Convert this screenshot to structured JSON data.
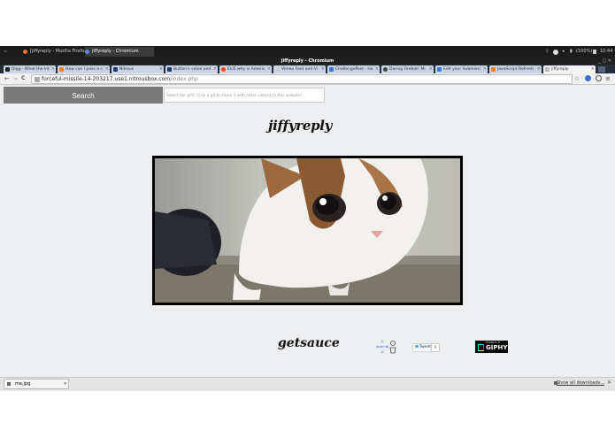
{
  "taskbar": {
    "menu_label": "~",
    "tasks": [
      {
        "label": "[jiffyreply - Mozilla Firefox]",
        "color": "#e8772e"
      },
      {
        "label": "jiffyreply - Chromium",
        "color": "#5b8fd9"
      }
    ],
    "battery": "(100%)",
    "time": "10:44"
  },
  "window": {
    "title": "jiffyreply - Chromium",
    "controls": "_ ▢ ✕"
  },
  "tabs": [
    {
      "label": "Digg - What the Inte",
      "fav": "#222222"
    },
    {
      "label": "How can I pass a c",
      "fav": "#f48024"
    },
    {
      "label": "Nitrous",
      "fav": "#1e3a6e"
    },
    {
      "label": "Button's value and",
      "fav": "#1e3a6e"
    },
    {
      "label": "ELI5 why is Americ",
      "fav": "#ff4500"
    },
    {
      "label": "Vimeo Font and Vi",
      "fav": "#cccccc"
    },
    {
      "label": "ChallengePost - Ha",
      "fav": "#3a7bd5"
    },
    {
      "label": "Daring Fireball: Mi",
      "fav": "#444444"
    },
    {
      "label": "Edit your Submissi",
      "fav": "#3a7bd5"
    },
    {
      "label": "JavaScript Refresh",
      "fav": "#f48024"
    },
    {
      "label": "jiffyreply",
      "fav": "#bbbbbb"
    }
  ],
  "address": {
    "host": "forceful-missile-14-203217.use1.nitrousbox.com",
    "path": "/index.php"
  },
  "nav": {
    "back": "←",
    "forward": "→",
    "reload": "C",
    "star": "☆",
    "menu": "≡"
  },
  "search": {
    "button_label": "Search",
    "placeholder": "Search for gifs! Click a gif to share it with other visitors to this website!"
  },
  "site": {
    "logo": "jiffyreply",
    "footer_logo": "getsauce"
  },
  "widgets": {
    "submit_label": "submit",
    "tweet_label": "Tweet",
    "tweet_count": "0",
    "giphy_small": "POWERED BY",
    "giphy_brand": "GIPHY"
  },
  "downloads": {
    "file": "me.jpg",
    "arrow": "▾",
    "show_all": "Show all downloads...",
    "close": "✕"
  },
  "colors": {
    "accent": "#3b6fd6",
    "page_bg": "#edeeef",
    "search_button": "#7a7a7a"
  }
}
